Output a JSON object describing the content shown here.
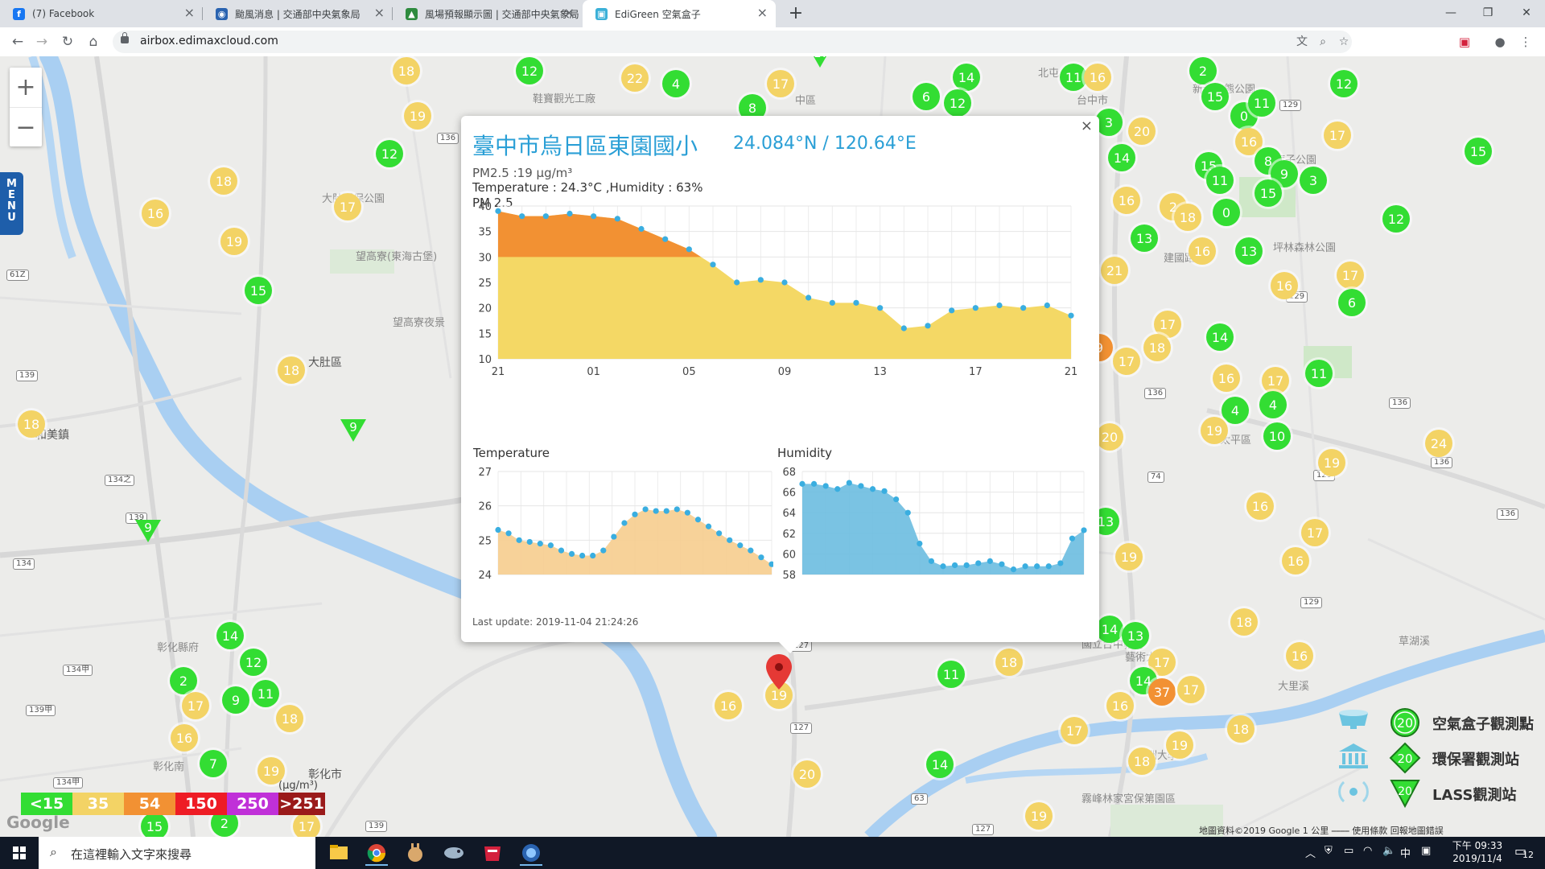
{
  "browser": {
    "tabs": [
      {
        "label": "(7) Facebook",
        "icon": "facebook-icon",
        "color": "#1877f2",
        "glyph": "f"
      },
      {
        "label": "颱風消息 | 交通部中央氣象局",
        "icon": "cwb-icon",
        "color": "#2a63b0",
        "glyph": "◉"
      },
      {
        "label": "風場預報顯示圖 | 交通部中央氣象局",
        "icon": "cwb-wind-icon",
        "color": "#2e8b3e",
        "glyph": "▲"
      },
      {
        "label": "EdiGreen 空氣盒子",
        "icon": "edigreen-icon",
        "color": "#3bb0d8",
        "glyph": "▣"
      }
    ],
    "url": "airbox.edimaxcloud.com"
  },
  "popup": {
    "title": "臺中市烏日區東園國小",
    "coords": "24.084°N / 120.64°E",
    "pm25_line": "PM2.5 :19 μg/m³",
    "temp_humidity_line": "Temperature : 24.3°C ,Humidity : 63%",
    "pm_chart_label": "PM 2.5",
    "temp_chart_label": "Temperature",
    "humidity_chart_label": "Humidity",
    "last_update": "Last update: 2019-11-04 21:24:26",
    "close": "×"
  },
  "chart_data": [
    {
      "type": "area",
      "title": "PM 2.5",
      "x_ticks": [
        "21",
        "01",
        "05",
        "09",
        "13",
        "17",
        "21"
      ],
      "y_ticks": [
        10,
        15,
        20,
        25,
        30,
        35,
        40
      ],
      "ylim": [
        10,
        40
      ],
      "threshold": 30,
      "values": [
        39,
        38,
        38,
        38.5,
        38,
        37.5,
        35.5,
        33.5,
        31.5,
        28.5,
        25,
        25.5,
        25,
        22,
        21,
        21,
        20,
        16,
        16.5,
        19.5,
        20,
        20.5,
        20,
        20.5,
        18.5
      ],
      "colors": {
        "below": "#f4d865",
        "above": "#f29133",
        "dot": "#3aaee0"
      }
    },
    {
      "type": "area",
      "title": "Temperature",
      "y_ticks": [
        24,
        25,
        26,
        27
      ],
      "ylim": [
        24,
        27
      ],
      "values": [
        25.3,
        25.2,
        25.0,
        24.95,
        24.9,
        24.85,
        24.7,
        24.6,
        24.55,
        24.55,
        24.7,
        25.1,
        25.5,
        25.75,
        25.9,
        25.85,
        25.85,
        25.9,
        25.8,
        25.6,
        25.4,
        25.2,
        25.0,
        24.85,
        24.7,
        24.5,
        24.3
      ],
      "colors": {
        "fill": "#f6cd8e",
        "dot": "#3aaee0"
      }
    },
    {
      "type": "area",
      "title": "Humidity",
      "y_ticks": [
        58,
        60,
        62,
        64,
        66,
        68
      ],
      "ylim": [
        58,
        68
      ],
      "values": [
        66.8,
        66.8,
        66.6,
        66.3,
        66.9,
        66.6,
        66.3,
        66.1,
        65.3,
        64.0,
        61.0,
        59.3,
        58.8,
        58.9,
        58.9,
        59.1,
        59.3,
        59.0,
        58.5,
        58.8,
        58.8,
        58.8,
        59.1,
        61.5,
        62.3
      ],
      "colors": {
        "fill": "#6cbde0",
        "dot": "#3aaee0"
      }
    }
  ],
  "map": {
    "labels": [
      {
        "text": "大肚區",
        "x": 383,
        "y": 440
      },
      {
        "text": "和美鎮",
        "x": 44,
        "y": 530
      },
      {
        "text": "彰化市",
        "x": 383,
        "y": 952
      },
      {
        "text": "大肚環保公園",
        "x": 400,
        "y": 236,
        "faint": true
      },
      {
        "text": "望高寮(東海古堡)",
        "x": 442,
        "y": 308,
        "faint": true
      },
      {
        "text": "望高寮夜景",
        "x": 488,
        "y": 390,
        "faint": true
      },
      {
        "text": "彰化縣府",
        "x": 195,
        "y": 794,
        "faint": true
      },
      {
        "text": "彰化南",
        "x": 190,
        "y": 942,
        "faint": true
      },
      {
        "text": "鞋寶觀光工廠",
        "x": 662,
        "y": 112,
        "faint": true
      },
      {
        "text": "中區",
        "x": 988,
        "y": 114,
        "faint": true
      },
      {
        "text": "北屯",
        "x": 1290,
        "y": 80,
        "faint": true
      },
      {
        "text": "台中市",
        "x": 1338,
        "y": 114,
        "faint": true
      },
      {
        "text": "新都生態公園",
        "x": 1482,
        "y": 100,
        "faint": true
      },
      {
        "text": "廍子公園",
        "x": 1584,
        "y": 188,
        "faint": true
      },
      {
        "text": "坪林森林公園",
        "x": 1582,
        "y": 297,
        "faint": true
      },
      {
        "text": "太平區",
        "x": 1516,
        "y": 536,
        "faint": true
      },
      {
        "text": "國立台中教育",
        "x": 1344,
        "y": 790,
        "faint": true
      },
      {
        "text": "藝術大學",
        "x": 1398,
        "y": 806,
        "faint": true
      },
      {
        "text": "霧峰林家宮保第園區",
        "x": 1344,
        "y": 982,
        "faint": true
      },
      {
        "text": "亞洲大學",
        "x": 1412,
        "y": 928,
        "faint": true
      },
      {
        "text": "草湖溪",
        "x": 1738,
        "y": 786,
        "faint": true
      },
      {
        "text": "大里溪",
        "x": 1588,
        "y": 842,
        "faint": true
      },
      {
        "text": "大度路",
        "x": 1308,
        "y": 160,
        "faint": true
      },
      {
        "text": "建國路",
        "x": 1446,
        "y": 310,
        "faint": true
      }
    ],
    "road_shields": [
      {
        "text": "136",
        "x": 543,
        "y": 165
      },
      {
        "text": "61Z",
        "x": 8,
        "y": 335
      },
      {
        "text": "139",
        "x": 20,
        "y": 460
      },
      {
        "text": "134之",
        "x": 130,
        "y": 590
      },
      {
        "text": "139",
        "x": 156,
        "y": 637
      },
      {
        "text": "134",
        "x": 16,
        "y": 694
      },
      {
        "text": "134甲",
        "x": 78,
        "y": 826
      },
      {
        "text": "139甲",
        "x": 32,
        "y": 876
      },
      {
        "text": "134甲",
        "x": 66,
        "y": 966
      },
      {
        "text": "127",
        "x": 982,
        "y": 796
      },
      {
        "text": "127",
        "x": 982,
        "y": 898
      },
      {
        "text": "129",
        "x": 1590,
        "y": 124
      },
      {
        "text": "129",
        "x": 1598,
        "y": 362
      },
      {
        "text": "129",
        "x": 1632,
        "y": 584
      },
      {
        "text": "129",
        "x": 1616,
        "y": 742
      },
      {
        "text": "136",
        "x": 1726,
        "y": 494
      },
      {
        "text": "136",
        "x": 1860,
        "y": 632
      },
      {
        "text": "136",
        "x": 1778,
        "y": 568
      },
      {
        "text": "136",
        "x": 1422,
        "y": 482
      },
      {
        "text": "139",
        "x": 454,
        "y": 1020
      },
      {
        "text": "74",
        "x": 1426,
        "y": 586
      },
      {
        "text": "63",
        "x": 1132,
        "y": 986
      },
      {
        "text": "127",
        "x": 1208,
        "y": 1024
      }
    ],
    "markers": [
      {
        "v": "18",
        "c": "y",
        "x": 505,
        "y": 88
      },
      {
        "v": "12",
        "c": "g",
        "x": 658,
        "y": 88
      },
      {
        "v": "22",
        "c": "y",
        "x": 789,
        "y": 97
      },
      {
        "v": "4",
        "c": "g",
        "x": 840,
        "y": 104
      },
      {
        "v": "17",
        "c": "y",
        "x": 970,
        "y": 104
      },
      {
        "v": "8",
        "c": "g",
        "x": 935,
        "y": 134
      },
      {
        "v": "19",
        "c": "y",
        "x": 519,
        "y": 144
      },
      {
        "v": "12",
        "c": "g",
        "x": 484,
        "y": 191
      },
      {
        "v": "18",
        "c": "y",
        "x": 278,
        "y": 225
      },
      {
        "v": "16",
        "c": "y",
        "x": 193,
        "y": 265
      },
      {
        "v": "17",
        "c": "y",
        "x": 432,
        "y": 257
      },
      {
        "v": "19",
        "c": "y",
        "x": 291,
        "y": 300
      },
      {
        "v": "15",
        "c": "g",
        "x": 321,
        "y": 361
      },
      {
        "v": "18",
        "c": "y",
        "x": 362,
        "y": 460
      },
      {
        "v": "18",
        "c": "y",
        "x": 39,
        "y": 527
      },
      {
        "v": "14",
        "c": "g",
        "x": 286,
        "y": 790
      },
      {
        "v": "12",
        "c": "g",
        "x": 315,
        "y": 823
      },
      {
        "v": "2",
        "c": "g",
        "x": 228,
        "y": 846
      },
      {
        "v": "17",
        "c": "y",
        "x": 243,
        "y": 877
      },
      {
        "v": "9",
        "c": "g",
        "x": 293,
        "y": 870
      },
      {
        "v": "11",
        "c": "g",
        "x": 330,
        "y": 862
      },
      {
        "v": "18",
        "c": "y",
        "x": 360,
        "y": 893
      },
      {
        "v": "16",
        "c": "y",
        "x": 229,
        "y": 917
      },
      {
        "v": "7",
        "c": "g",
        "x": 265,
        "y": 949
      },
      {
        "v": "19",
        "c": "y",
        "x": 337,
        "y": 958
      },
      {
        "v": "15",
        "c": "g",
        "x": 192,
        "y": 1027
      },
      {
        "v": "2",
        "c": "g",
        "x": 279,
        "y": 1023
      },
      {
        "v": "17",
        "c": "y",
        "x": 381,
        "y": 1027
      },
      {
        "v": "16",
        "c": "y",
        "x": 905,
        "y": 877
      },
      {
        "v": "19",
        "c": "y",
        "x": 968,
        "y": 864
      },
      {
        "v": "20",
        "c": "y",
        "x": 1003,
        "y": 962
      },
      {
        "v": "11",
        "c": "g",
        "x": 1182,
        "y": 838
      },
      {
        "v": "14",
        "c": "g",
        "x": 1168,
        "y": 950
      },
      {
        "v": "18",
        "c": "y",
        "x": 1254,
        "y": 823
      },
      {
        "v": "17",
        "c": "y",
        "x": 1335,
        "y": 908
      },
      {
        "v": "19",
        "c": "y",
        "x": 1291,
        "y": 1014
      },
      {
        "v": "6",
        "c": "g",
        "x": 1151,
        "y": 120
      },
      {
        "v": "14",
        "c": "g",
        "x": 1201,
        "y": 96
      },
      {
        "v": "12",
        "c": "g",
        "x": 1190,
        "y": 128
      },
      {
        "v": "11",
        "c": "g",
        "x": 1334,
        "y": 96
      },
      {
        "v": "16",
        "c": "y",
        "x": 1364,
        "y": 96
      },
      {
        "v": "3",
        "c": "g",
        "x": 1378,
        "y": 152
      },
      {
        "v": "20",
        "c": "y",
        "x": 1419,
        "y": 163
      },
      {
        "v": "14",
        "c": "g",
        "x": 1394,
        "y": 196
      },
      {
        "v": "16",
        "c": "y",
        "x": 1400,
        "y": 249
      },
      {
        "v": "13",
        "c": "g",
        "x": 1422,
        "y": 296
      },
      {
        "v": "21",
        "c": "y",
        "x": 1385,
        "y": 336
      },
      {
        "v": "17",
        "c": "y",
        "x": 1451,
        "y": 403
      },
      {
        "v": "18",
        "c": "y",
        "x": 1438,
        "y": 432
      },
      {
        "v": "17",
        "c": "y",
        "x": 1400,
        "y": 449
      },
      {
        "v": "9",
        "c": "o",
        "x": 1366,
        "y": 432
      },
      {
        "v": "20",
        "c": "y",
        "x": 1379,
        "y": 543
      },
      {
        "v": "13",
        "c": "g",
        "x": 1374,
        "y": 648
      },
      {
        "v": "19",
        "c": "y",
        "x": 1403,
        "y": 692
      },
      {
        "v": "14",
        "c": "g",
        "x": 1379,
        "y": 782
      },
      {
        "v": "13",
        "c": "g",
        "x": 1411,
        "y": 790
      },
      {
        "v": "17",
        "c": "y",
        "x": 1444,
        "y": 823
      },
      {
        "v": "14",
        "c": "g",
        "x": 1421,
        "y": 846
      },
      {
        "v": "37",
        "c": "o",
        "x": 1444,
        "y": 860
      },
      {
        "v": "17",
        "c": "y",
        "x": 1480,
        "y": 857
      },
      {
        "v": "16",
        "c": "y",
        "x": 1392,
        "y": 877
      },
      {
        "v": "18",
        "c": "y",
        "x": 1419,
        "y": 946
      },
      {
        "v": "19",
        "c": "y",
        "x": 1466,
        "y": 926
      },
      {
        "v": "18",
        "c": "y",
        "x": 1542,
        "y": 906
      },
      {
        "v": "2",
        "c": "g",
        "x": 1495,
        "y": 88
      },
      {
        "v": "15",
        "c": "g",
        "x": 1510,
        "y": 120
      },
      {
        "v": "0",
        "c": "g",
        "x": 1546,
        "y": 144
      },
      {
        "v": "11",
        "c": "g",
        "x": 1568,
        "y": 128
      },
      {
        "v": "12",
        "c": "g",
        "x": 1670,
        "y": 104
      },
      {
        "v": "17",
        "c": "y",
        "x": 1662,
        "y": 168
      },
      {
        "v": "16",
        "c": "y",
        "x": 1552,
        "y": 176
      },
      {
        "v": "15",
        "c": "g",
        "x": 1502,
        "y": 206
      },
      {
        "v": "11",
        "c": "g",
        "x": 1516,
        "y": 224
      },
      {
        "v": "8",
        "c": "g",
        "x": 1576,
        "y": 200
      },
      {
        "v": "9",
        "c": "g",
        "x": 1596,
        "y": 216
      },
      {
        "v": "15",
        "c": "g",
        "x": 1576,
        "y": 240
      },
      {
        "v": "3",
        "c": "g",
        "x": 1632,
        "y": 224
      },
      {
        "v": "2",
        "c": "y",
        "x": 1458,
        "y": 257
      },
      {
        "v": "18",
        "c": "y",
        "x": 1476,
        "y": 270
      },
      {
        "v": "0",
        "c": "g",
        "x": 1524,
        "y": 264
      },
      {
        "v": "16",
        "c": "y",
        "x": 1494,
        "y": 312
      },
      {
        "v": "13",
        "c": "g",
        "x": 1552,
        "y": 312
      },
      {
        "v": "16",
        "c": "y",
        "x": 1596,
        "y": 355
      },
      {
        "v": "14",
        "c": "g",
        "x": 1516,
        "y": 419
      },
      {
        "v": "16",
        "c": "y",
        "x": 1524,
        "y": 470
      },
      {
        "v": "17",
        "c": "y",
        "x": 1585,
        "y": 473
      },
      {
        "v": "4",
        "c": "g",
        "x": 1535,
        "y": 510
      },
      {
        "v": "4",
        "c": "g",
        "x": 1582,
        "y": 503
      },
      {
        "v": "19",
        "c": "y",
        "x": 1509,
        "y": 535
      },
      {
        "v": "10",
        "c": "g",
        "x": 1587,
        "y": 542
      },
      {
        "v": "11",
        "c": "g",
        "x": 1639,
        "y": 464
      },
      {
        "v": "16",
        "c": "y",
        "x": 1566,
        "y": 629
      },
      {
        "v": "17",
        "c": "y",
        "x": 1634,
        "y": 662
      },
      {
        "v": "16",
        "c": "y",
        "x": 1610,
        "y": 697
      },
      {
        "v": "18",
        "c": "y",
        "x": 1546,
        "y": 773
      },
      {
        "v": "16",
        "c": "y",
        "x": 1615,
        "y": 815
      },
      {
        "v": "15",
        "c": "g",
        "x": 1837,
        "y": 188
      },
      {
        "v": "12",
        "c": "g",
        "x": 1735,
        "y": 272
      },
      {
        "v": "17",
        "c": "y",
        "x": 1678,
        "y": 342
      },
      {
        "v": "6",
        "c": "g",
        "x": 1680,
        "y": 376
      },
      {
        "v": "24",
        "c": "y",
        "x": 1788,
        "y": 551
      },
      {
        "v": "19",
        "c": "y",
        "x": 1655,
        "y": 575
      }
    ],
    "triangles": [
      {
        "v": "9",
        "x": 439,
        "y": 535
      },
      {
        "v": "9",
        "x": 184,
        "y": 660
      },
      {
        "v": "17",
        "x": 1019,
        "y": 70
      }
    ]
  },
  "legend": {
    "scale": [
      {
        "label": "<15",
        "color": "#33dd33"
      },
      {
        "label": "35",
        "color": "#f3d365"
      },
      {
        "label": "54",
        "color": "#f29133"
      },
      {
        "label": "150",
        "color": "#ee1c25"
      },
      {
        "label": "250",
        "color": "#c030d8"
      },
      {
        "label": ">251",
        "color": "#9a1a1a"
      }
    ],
    "unit": "(μg/m³)",
    "sources": [
      {
        "label": "空氣盒子觀測點",
        "value": "20"
      },
      {
        "label": "環保署觀測站",
        "value": "20"
      },
      {
        "label": "LASS觀測站",
        "value": "20"
      }
    ]
  },
  "map_ui": {
    "zoom_in": "+",
    "zoom_out": "−",
    "menu": "MENU",
    "google": "Google",
    "attribution": "地圖資料©2019 Google   1 公里 ⎯⎯⎯⎯    使用條款   回報地圖錯誤"
  },
  "taskbar": {
    "search_placeholder": "在這裡輸入文字來搜尋",
    "time": "下午 09:33",
    "date": "2019/11/4",
    "ime": "中",
    "notification_count": "12"
  }
}
